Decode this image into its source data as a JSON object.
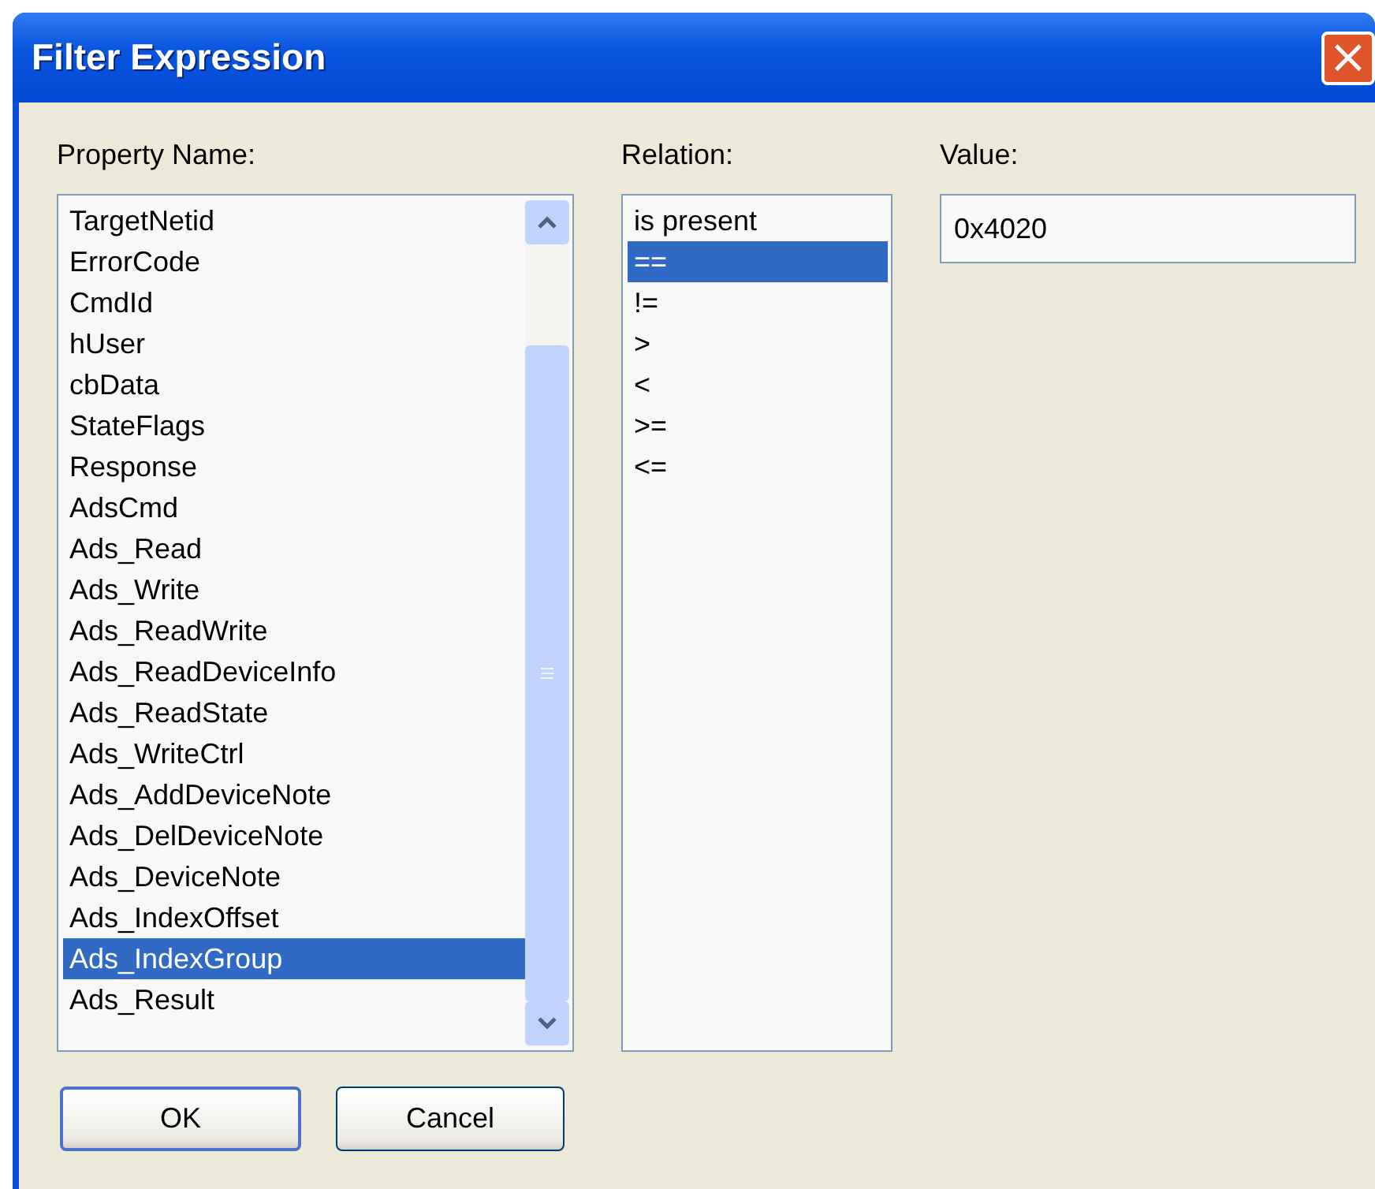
{
  "window": {
    "title": "Filter Expression",
    "close": "×"
  },
  "property_name": {
    "label": "Property Name:",
    "items": [
      {
        "text": "TargetNetid",
        "selected": false
      },
      {
        "text": "ErrorCode",
        "selected": false
      },
      {
        "text": "CmdId",
        "selected": false
      },
      {
        "text": "hUser",
        "selected": false
      },
      {
        "text": "cbData",
        "selected": false
      },
      {
        "text": "StateFlags",
        "selected": false
      },
      {
        "text": "Response",
        "selected": false
      },
      {
        "text": "AdsCmd",
        "selected": false
      },
      {
        "text": "Ads_Read",
        "selected": false
      },
      {
        "text": "Ads_Write",
        "selected": false
      },
      {
        "text": "Ads_ReadWrite",
        "selected": false
      },
      {
        "text": "Ads_ReadDeviceInfo",
        "selected": false
      },
      {
        "text": "Ads_ReadState",
        "selected": false
      },
      {
        "text": "Ads_WriteCtrl",
        "selected": false
      },
      {
        "text": "Ads_AddDeviceNote",
        "selected": false
      },
      {
        "text": "Ads_DelDeviceNote",
        "selected": false
      },
      {
        "text": "Ads_DeviceNote",
        "selected": false
      },
      {
        "text": "Ads_IndexOffset",
        "selected": false
      },
      {
        "text": "Ads_IndexGroup",
        "selected": true
      },
      {
        "text": "Ads_Result",
        "selected": false
      }
    ]
  },
  "relation": {
    "label": "Relation:",
    "items": [
      {
        "text": "is present",
        "selected": false
      },
      {
        "text": "==",
        "selected": true
      },
      {
        "text": "!=",
        "selected": false
      },
      {
        "text": ">",
        "selected": false
      },
      {
        "text": "<",
        "selected": false
      },
      {
        "text": ">=",
        "selected": false
      },
      {
        "text": "<=",
        "selected": false
      }
    ]
  },
  "value": {
    "label": "Value:",
    "value": "0x4020"
  },
  "buttons": [
    {
      "label": "OK",
      "default": true
    },
    {
      "label": "Cancel",
      "default": false
    }
  ]
}
